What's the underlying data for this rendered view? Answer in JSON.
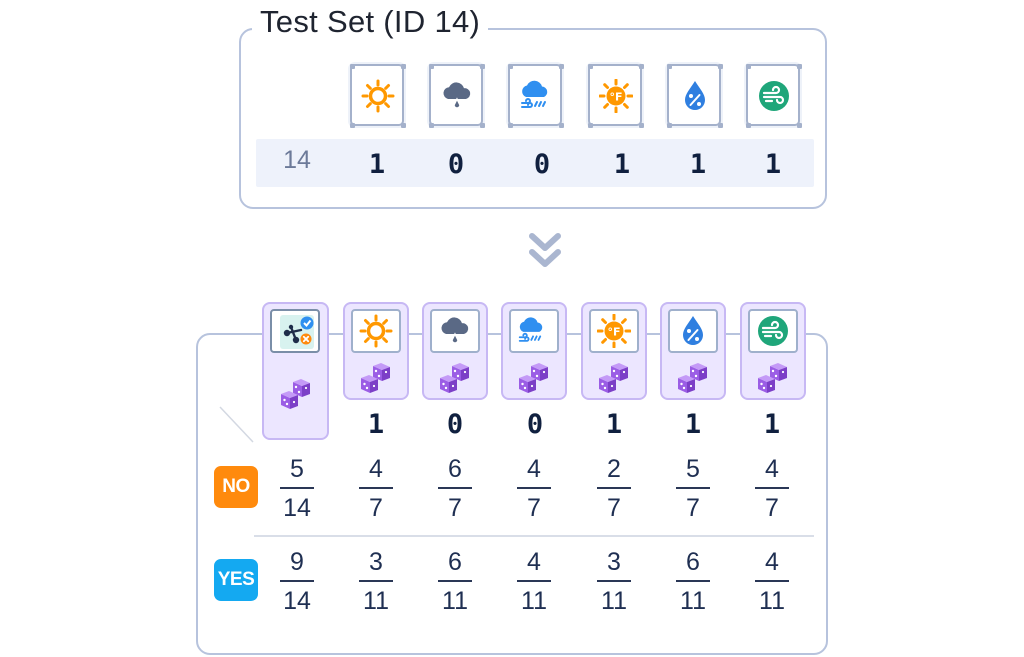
{
  "test_set": {
    "title": "Test Set (ID 14)",
    "id": "14",
    "feature_icons": [
      "sun-icon",
      "rain-cloud-icon",
      "windy-cloud-icon",
      "hot-temperature-icon",
      "humidity-drop-icon",
      "wind-icon"
    ],
    "values": [
      "1",
      "0",
      "0",
      "1",
      "1",
      "1"
    ]
  },
  "model": {
    "class_icon": "play-decision-icon",
    "feature_icons": [
      "sun-icon",
      "rain-cloud-icon",
      "windy-cloud-icon",
      "hot-temperature-icon",
      "humidity-drop-icon",
      "wind-icon"
    ],
    "values": [
      "1",
      "0",
      "0",
      "1",
      "1",
      "1"
    ],
    "rows": [
      {
        "label": "NO",
        "color": "#ff8a0d",
        "prior": {
          "num": "5",
          "den": "14"
        },
        "likelihoods": [
          {
            "num": "4",
            "den": "7"
          },
          {
            "num": "6",
            "den": "7"
          },
          {
            "num": "4",
            "den": "7"
          },
          {
            "num": "2",
            "den": "7"
          },
          {
            "num": "5",
            "den": "7"
          },
          {
            "num": "4",
            "den": "7"
          }
        ]
      },
      {
        "label": "YES",
        "color": "#14a9f1",
        "prior": {
          "num": "9",
          "den": "14"
        },
        "likelihoods": [
          {
            "num": "3",
            "den": "11"
          },
          {
            "num": "6",
            "den": "11"
          },
          {
            "num": "4",
            "den": "11"
          },
          {
            "num": "3",
            "den": "11"
          },
          {
            "num": "6",
            "den": "11"
          },
          {
            "num": "4",
            "den": "11"
          }
        ]
      }
    ]
  },
  "colors": {
    "border": "#b7c3dd",
    "pill": "#ece6ff",
    "dice": "#9b5de5",
    "sun": "#ff9800",
    "drop": "#2f7fe0",
    "wind": "#1fa67a"
  }
}
